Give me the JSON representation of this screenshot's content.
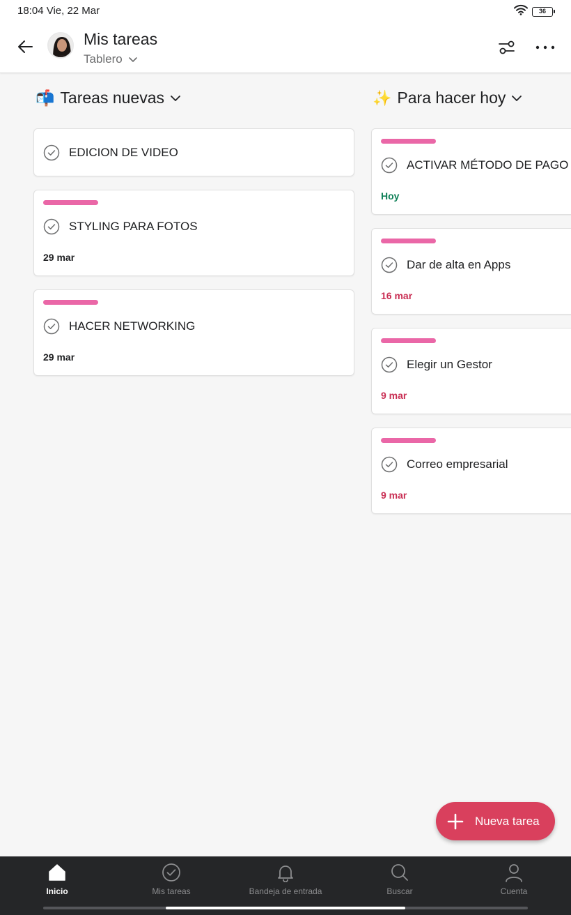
{
  "status_bar": {
    "time": "18:04 Vie, 22 Mar",
    "battery": "36"
  },
  "header": {
    "title": "Mis tareas",
    "view": "Tablero"
  },
  "columns": [
    {
      "emoji": "📬",
      "title": "Tareas nuevas",
      "cards": [
        {
          "title": "EDICION DE VIDEO",
          "date": ""
        },
        {
          "title": "STYLING PARA FOTOS",
          "date": "29 mar"
        },
        {
          "title": "HACER NETWORKING",
          "date": "29 mar"
        }
      ]
    },
    {
      "emoji": "✨",
      "title": "Para hacer hoy",
      "cards": [
        {
          "title": "ACTIVAR MÉTODO DE PAGO",
          "date": "Hoy"
        },
        {
          "title": "Dar de alta en Apps",
          "date": "16 mar"
        },
        {
          "title": "Elegir un Gestor",
          "date": "9 mar"
        },
        {
          "title": "Correo empresarial",
          "date": "9 mar"
        }
      ]
    }
  ],
  "fab": {
    "label": "Nueva tarea"
  },
  "bottom_nav": [
    {
      "label": "Inicio",
      "icon": "home-icon",
      "active": true
    },
    {
      "label": "Mis tareas",
      "icon": "check-circle-icon",
      "active": false
    },
    {
      "label": "Bandeja de entrada",
      "icon": "bell-icon",
      "active": false
    },
    {
      "label": "Buscar",
      "icon": "search-icon",
      "active": false
    },
    {
      "label": "Cuenta",
      "icon": "person-icon",
      "active": false
    }
  ],
  "colors": {
    "tag": "#ea67a7",
    "date_today": "#0d7f56",
    "date_overdue": "#c92f54",
    "fab": "#d9405d",
    "nav_background": "#252628"
  }
}
